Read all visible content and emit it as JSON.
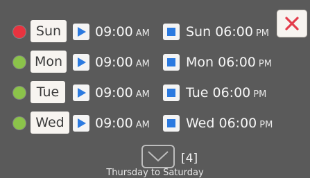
{
  "close_icon": "close-icon",
  "colors": {
    "background": "#5a5a5a",
    "accent_blue": "#2b7ae0",
    "close_red": "#e33b4a",
    "status_red": "#e8333f",
    "status_green": "#8bc34a"
  },
  "schedule": [
    {
      "day": "Sun",
      "status": "red",
      "start_time": "09:00",
      "start_ampm": "AM",
      "end_day": "Sun",
      "end_time": "06:00",
      "end_ampm": "PM"
    },
    {
      "day": "Mon",
      "status": "green",
      "start_time": "09:00",
      "start_ampm": "AM",
      "end_day": "Mon",
      "end_time": "06:00",
      "end_ampm": "PM"
    },
    {
      "day": "Tue",
      "status": "green",
      "start_time": "09:00",
      "start_ampm": "AM",
      "end_day": "Tue",
      "end_time": "06:00",
      "end_ampm": "PM"
    },
    {
      "day": "Wed",
      "status": "green",
      "start_time": "09:00",
      "start_ampm": "AM",
      "end_day": "Wed",
      "end_time": "06:00",
      "end_ampm": "PM"
    }
  ],
  "footer": {
    "icon": "chevron-down-icon",
    "count": "[4]",
    "caption": "Thursday to Saturday"
  }
}
